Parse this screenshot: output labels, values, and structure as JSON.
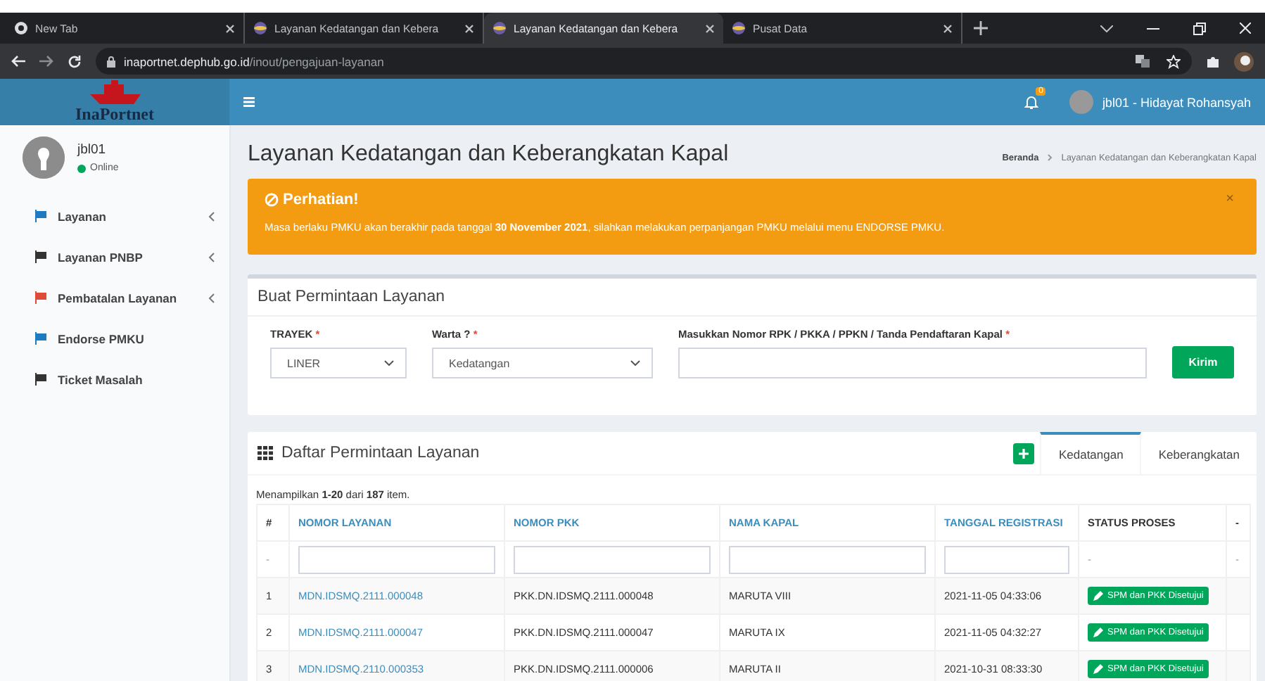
{
  "browser": {
    "tabs": [
      {
        "title": "New Tab",
        "selected": false,
        "kind": "chrome"
      },
      {
        "title": "Layanan Kedatangan dan Kebera",
        "selected": false,
        "kind": "site"
      },
      {
        "title": "Layanan Kedatangan dan Kebera",
        "selected": true,
        "kind": "site"
      },
      {
        "title": "Pusat Data",
        "selected": false,
        "kind": "site"
      }
    ],
    "url": {
      "host": "inaportnet.dephub.go.id",
      "path": "/inout/pengajuan-layanan"
    }
  },
  "header": {
    "logo": "InaPortnet",
    "notifications": "0",
    "user": "jbl01 - Hidayat Rohansyah"
  },
  "sidebar": {
    "user": {
      "name": "jbl01",
      "status": "Online"
    },
    "items": [
      {
        "label": "Layanan",
        "color": "#1f7bc1",
        "submenu": true
      },
      {
        "label": "Layanan PNBP",
        "color": "#333333",
        "submenu": true
      },
      {
        "label": "Pembatalan Layanan",
        "color": "#dd4b39",
        "submenu": true
      },
      {
        "label": "Endorse PMKU",
        "color": "#1f7bc1",
        "submenu": false
      },
      {
        "label": "Ticket Masalah",
        "color": "#333333",
        "submenu": false
      }
    ]
  },
  "page": {
    "title": "Layanan Kedatangan dan Keberangkatan Kapal",
    "breadcrumb": [
      "Beranda",
      "Layanan Kedatangan dan Keberangkatan Kapal"
    ]
  },
  "alert": {
    "title": "Perhatian!",
    "text": "Masa berlaku PMKU akan berakhir pada tanggal **30 November 2021**, silahkan melakukan perpanjangan PMKU melalui menu ENDORSE PMKU.",
    "close": "×"
  },
  "form": {
    "title": "Buat Permintaan Layanan",
    "fields": [
      {
        "kind": "select",
        "label": "TRAYEK",
        "required_mark": "*",
        "value": "LINER"
      },
      {
        "kind": "select",
        "label": "Warta ?",
        "required_mark": "*",
        "value": "Kedatangan"
      },
      {
        "kind": "text",
        "label": "Masukkan Nomor RPK / PKKA / PPKN / Tanda Pendaftaran Kapal",
        "required_mark": "*"
      }
    ],
    "submit": "Kirim"
  },
  "list": {
    "title": "Daftar Permintaan Layanan",
    "tabs": [
      {
        "label": "Kedatangan",
        "selected": true
      },
      {
        "label": "Keberangkatan",
        "selected": false
      }
    ],
    "summary": "Menampilkan **1-20** dari **187** item.",
    "columns": [
      {
        "label": "#",
        "sortable": false
      },
      {
        "label": "NOMOR LAYANAN",
        "sortable": true
      },
      {
        "label": "NOMOR PKK",
        "sortable": true
      },
      {
        "label": "NAMA KAPAL",
        "sortable": true
      },
      {
        "label": "TANGGAL REGISTRASI",
        "sortable": true
      },
      {
        "label": "STATUS PROSES",
        "sortable": false
      },
      {
        "label": "-",
        "sortable": false
      }
    ],
    "filters": [
      {
        "kind": "text",
        "text": "-"
      },
      {
        "kind": "input"
      },
      {
        "kind": "input"
      },
      {
        "kind": "input"
      },
      {
        "kind": "input"
      },
      {
        "kind": "text",
        "text": "-"
      },
      {
        "kind": "text",
        "text": "-"
      }
    ],
    "rows": [
      {
        "no": "1",
        "nomor_layanan": "MDN.IDSMQ.2111.000048",
        "nomor_pkk": "PKK.DN.IDSMQ.2111.000048",
        "nama_kapal": "MARUTA VIII",
        "tanggal": "2021-11-05 04:33:06",
        "status": "SPM dan PKK Disetujui"
      },
      {
        "no": "2",
        "nomor_layanan": "MDN.IDSMQ.2111.000047",
        "nomor_pkk": "PKK.DN.IDSMQ.2111.000047",
        "nama_kapal": "MARUTA IX",
        "tanggal": "2021-11-05 04:32:27",
        "status": "SPM dan PKK Disetujui"
      },
      {
        "no": "3",
        "nomor_layanan": "MDN.IDSMQ.2110.000353",
        "nomor_pkk": "PKK.DN.IDSMQ.2111.000006",
        "nama_kapal": "MARUTA II",
        "tanggal": "2021-10-31 08:33:30",
        "status": "SPM dan PKK Disetujui"
      }
    ]
  }
}
